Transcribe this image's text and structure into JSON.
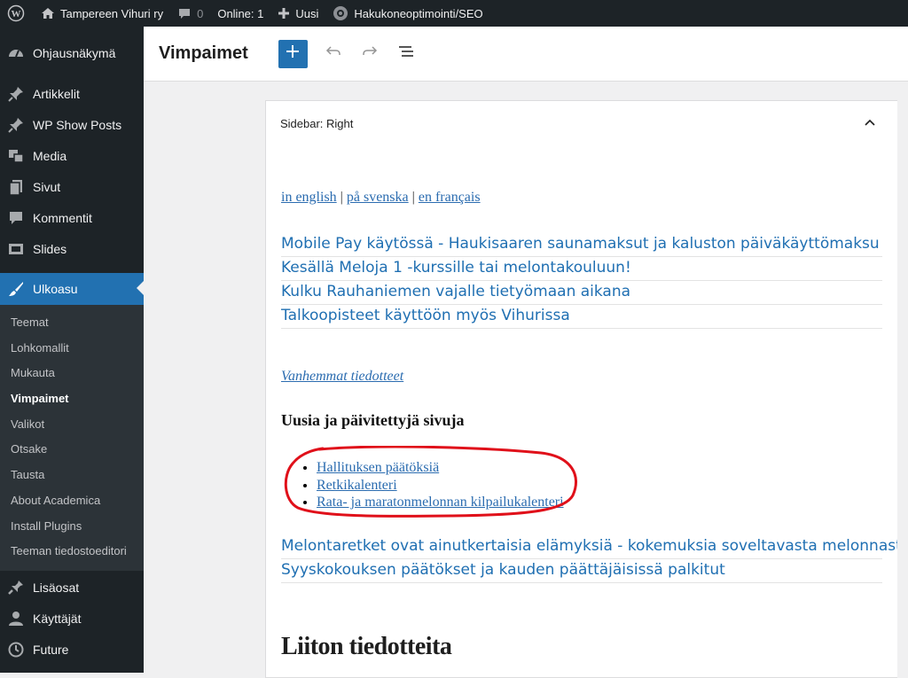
{
  "admin_bar": {
    "site_name": "Tampereen Vihuri ry",
    "comments_count": "0",
    "online": "Online: 1",
    "new_label": "Uusi",
    "seo_label": "Hakukoneoptimointi/SEO"
  },
  "sidebar": {
    "items": [
      {
        "label": "Ohjausnäkymä",
        "icon": "dashboard-icon"
      },
      {
        "label": "Artikkelit",
        "icon": "pin-icon"
      },
      {
        "label": "WP Show Posts",
        "icon": "pin-icon"
      },
      {
        "label": "Media",
        "icon": "media-icon"
      },
      {
        "label": "Sivut",
        "icon": "pages-icon"
      },
      {
        "label": "Kommentit",
        "icon": "comment-icon"
      },
      {
        "label": "Slides",
        "icon": "slides-icon"
      },
      {
        "label": "Ulkoasu",
        "icon": "brush-icon"
      }
    ],
    "submenu": [
      "Teemat",
      "Lohkomallit",
      "Mukauta",
      "Vimpaimet",
      "Valikot",
      "Otsake",
      "Tausta",
      "About Academica",
      "Install Plugins",
      "Teeman tiedostoeditori"
    ],
    "bottom": [
      {
        "label": "Lisäosat",
        "icon": "plugin-icon"
      },
      {
        "label": "Käyttäjät",
        "icon": "user-icon"
      },
      {
        "label": "Future",
        "icon": "clock-icon"
      }
    ]
  },
  "header": {
    "title": "Vimpaimet"
  },
  "panel": {
    "title": "Sidebar: Right",
    "languages": [
      "in english",
      "på svenska",
      "en français"
    ],
    "lang_separator": " | ",
    "news_top": [
      "Mobile Pay käytössä - Haukisaaren saunamaksut ja kaluston päiväkäyttömaksu",
      "Kesällä Meloja 1 -kurssille tai melontakouluun!",
      "Kulku Rauhaniemen vajalle tietyömaan aikana",
      "Talkoopisteet käyttöön myös Vihurissa"
    ],
    "older_link": "Vanhemmat tiedotteet",
    "recent_heading": "Uusia ja päivitettyjä sivuja",
    "recent_pages": [
      "Hallituksen päätöksiä",
      "Retkikalenteri",
      "Rata- ja maratonmelonnan kilpailukalenteri"
    ],
    "news_bottom": [
      "Melontaretket ovat ainutkertaisia elämyksiä - kokemuksia soveltavasta melonnasta.",
      "Syyskokouksen päätökset ja kauden päättäjäisissä palkitut"
    ],
    "liiton_heading": "Liiton tiedotteita"
  },
  "colors": {
    "accent": "#2271b1",
    "admin_dark": "#1d2327",
    "annotation": "#e0101a"
  }
}
